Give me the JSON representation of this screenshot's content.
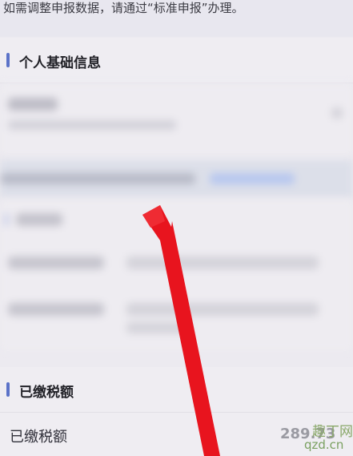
{
  "notice": {
    "text": "如需调整申报数据，请通过“标准申报”办理。"
  },
  "sections": {
    "personal_info": {
      "title": "个人基础信息"
    },
    "paid_tax": {
      "title": "已缴税额"
    }
  },
  "paid_tax_row": {
    "label": "已缴税额",
    "value": "289.73"
  },
  "watermark": {
    "line1": "趣丁网",
    "line2": "qzd.cn"
  },
  "colors": {
    "accent_bar": "#5b72c8",
    "annotation_arrow": "#e8141e",
    "link_blue": "#b7c7ef"
  }
}
